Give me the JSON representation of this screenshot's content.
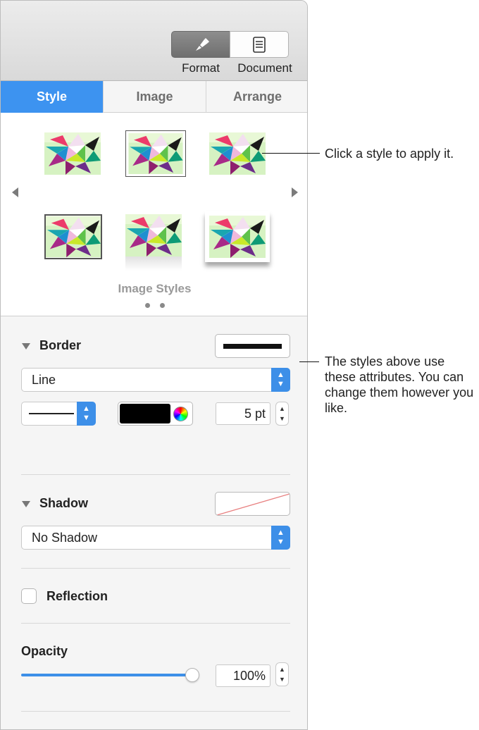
{
  "header": {
    "buttons": [
      {
        "label": "Format",
        "icon": "paintbrush-icon",
        "selected": true
      },
      {
        "label": "Document",
        "icon": "document-icon",
        "selected": false
      }
    ]
  },
  "tabs": [
    {
      "label": "Style",
      "active": true
    },
    {
      "label": "Image",
      "active": false
    },
    {
      "label": "Arrange",
      "active": false
    }
  ],
  "gallery": {
    "title": "Image Styles",
    "page_count": 2,
    "current_page": 1,
    "thumbnail_count": 6,
    "selected_index": 1
  },
  "border": {
    "title": "Border",
    "type_value": "Line",
    "width_value": "5 pt",
    "color": "#000000"
  },
  "shadow": {
    "title": "Shadow",
    "value": "No Shadow"
  },
  "reflection": {
    "label": "Reflection",
    "checked": false
  },
  "opacity": {
    "title": "Opacity",
    "value": "100%",
    "level": 1.0
  },
  "callouts": {
    "styles": "Click a style to apply it.",
    "attributes": "The styles above use these attributes. You can change them however you like."
  },
  "colors": {
    "accent": "#3d93f0",
    "panel_bg": "#f5f5f5"
  }
}
